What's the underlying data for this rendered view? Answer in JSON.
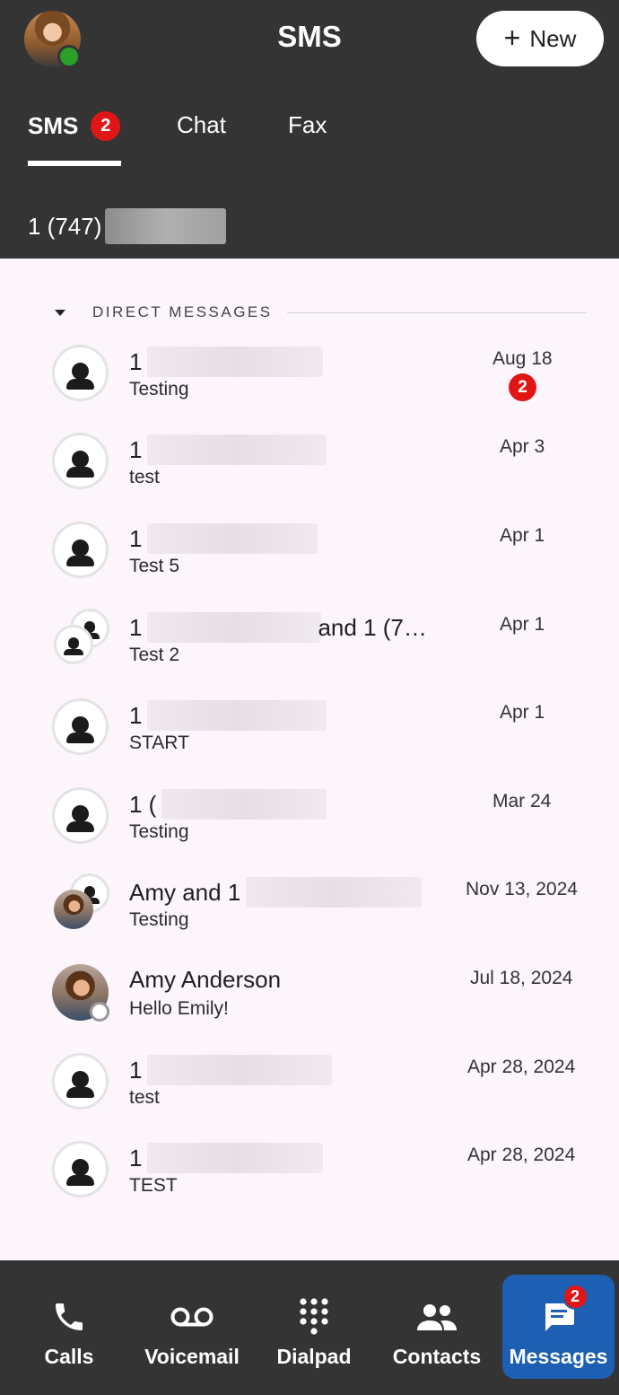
{
  "header": {
    "title": "SMS",
    "new_button": {
      "icon": "plus-icon",
      "label": "New"
    },
    "tabs": [
      {
        "label": "SMS",
        "badge": "2",
        "active": true
      },
      {
        "label": "Chat"
      },
      {
        "label": "Fax"
      }
    ],
    "my_number_prefix": "1 (747)"
  },
  "section": {
    "label": "DIRECT MESSAGES"
  },
  "conversations": [
    {
      "name": "1",
      "preview": "Testing",
      "date": "Aug 18",
      "badge": "2",
      "avatar": "person-icon"
    },
    {
      "name": "1",
      "preview": "test",
      "date": "Apr 3",
      "avatar": "person-icon"
    },
    {
      "name": "1",
      "preview": "Test 5",
      "date": "Apr 1",
      "avatar": "person-icon"
    },
    {
      "name": "1",
      "name_suffix": "and 1 (7…",
      "preview": "Test 2",
      "date": "Apr 1",
      "avatar": "group-icon"
    },
    {
      "name": "1",
      "preview": "START",
      "date": "Apr 1",
      "avatar": "person-icon"
    },
    {
      "name": "1 (",
      "preview": "Testing",
      "date": "Mar 24",
      "avatar": "person-icon"
    },
    {
      "name": "Amy and 1",
      "preview": "Testing",
      "date": "Nov 13, 2024",
      "avatar": "group-photo"
    },
    {
      "name": "Amy Anderson",
      "preview": "Hello Emily!",
      "date": "Jul 18, 2024",
      "avatar": "photo"
    },
    {
      "name": "1",
      "preview": "test",
      "date": "Apr 28, 2024",
      "avatar": "person-icon"
    },
    {
      "name": "1",
      "preview": "TEST",
      "date": "Apr 28, 2024",
      "avatar": "person-icon"
    }
  ],
  "bottom_nav": [
    {
      "label": "Calls",
      "icon": "phone-icon"
    },
    {
      "label": "Voicemail",
      "icon": "voicemail-icon"
    },
    {
      "label": "Dialpad",
      "icon": "dialpad-icon"
    },
    {
      "label": "Contacts",
      "icon": "contacts-icon"
    },
    {
      "label": "Messages",
      "icon": "messages-icon",
      "badge": "2",
      "active": true
    }
  ],
  "colors": {
    "header_bg": "#343434",
    "badge": "#e01616",
    "active_nav": "#1d5fb3",
    "presence_online": "#2aa02a",
    "list_bg": "#fcf5fc"
  }
}
